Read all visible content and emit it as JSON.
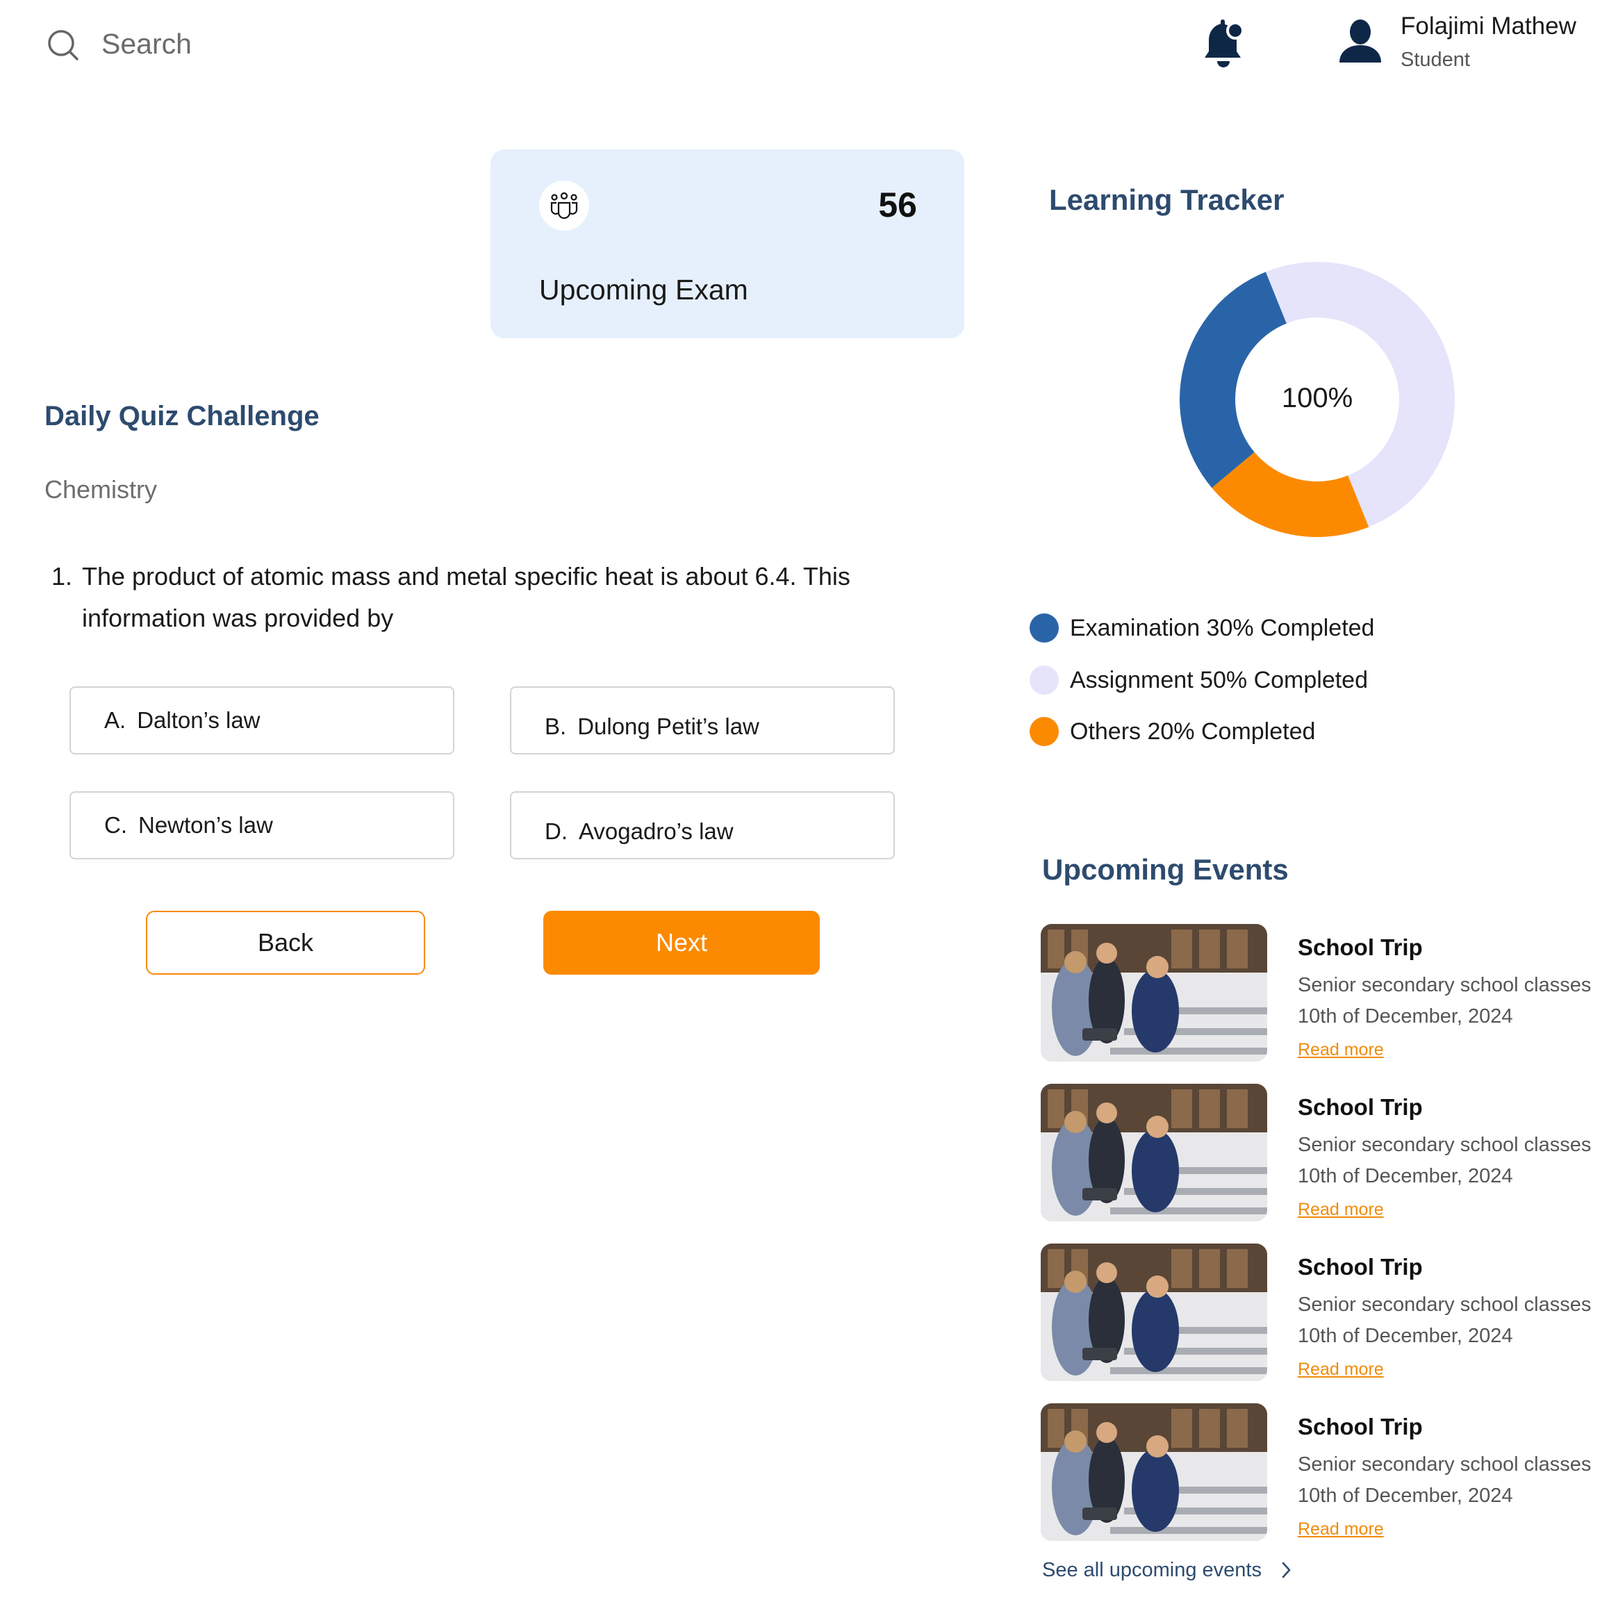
{
  "header": {
    "search_placeholder": "Search",
    "user": {
      "name": "Folajimi Mathew",
      "role": "Student"
    },
    "icons": [
      "search-icon",
      "bell-icon",
      "user-icon"
    ]
  },
  "exam_card": {
    "count": "56",
    "label": "Upcoming Exam",
    "icon": "group-icon"
  },
  "quiz": {
    "title": "Daily Quiz Challenge",
    "subject": "Chemistry",
    "question_number": "1.",
    "question_text": "The product of atomic mass and metal specific heat is about 6.4. This information was provided by",
    "options": [
      {
        "letter": "A.",
        "text": "Dalton’s law"
      },
      {
        "letter": "B.",
        "text": "Dulong Petit’s law"
      },
      {
        "letter": "C.",
        "text": "Newton’s law"
      },
      {
        "letter": "D.",
        "text": "Avogadro’s law"
      }
    ],
    "back_label": "Back",
    "next_label": "Next"
  },
  "tracker": {
    "title": "Learning Tracker",
    "center_label": "100%",
    "segments": [
      {
        "label": "Examination 30% Completed",
        "percent": 30,
        "color": "#2a64a8"
      },
      {
        "label": "Assignment 50% Completed",
        "percent": 50,
        "color": "#e5e4fb"
      },
      {
        "label": "Others 20% Completed",
        "percent": 20,
        "color": "#fb8a00"
      }
    ]
  },
  "events": {
    "title": "Upcoming Events",
    "items": [
      {
        "title": "School Trip",
        "description": "Senior secondary school classes",
        "date": "10th of December, 2024",
        "link": "Read more"
      },
      {
        "title": "School Trip",
        "description": "Senior secondary school classes",
        "date": "10th of December, 2024",
        "link": "Read more"
      },
      {
        "title": "School Trip",
        "description": "Senior secondary school classes",
        "date": "10th of December, 2024",
        "link": "Read more"
      },
      {
        "title": "School Trip",
        "description": "Senior secondary school classes",
        "date": "10th of December, 2024",
        "link": "Read more"
      }
    ],
    "see_all": "See all upcoming events"
  }
}
